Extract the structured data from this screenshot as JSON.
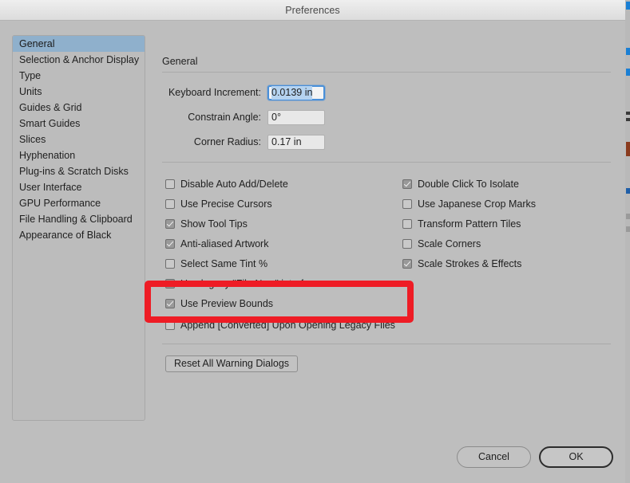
{
  "window": {
    "title": "Preferences"
  },
  "sidebar": {
    "items": [
      {
        "label": "General",
        "selected": true
      },
      {
        "label": "Selection & Anchor Display",
        "selected": false
      },
      {
        "label": "Type",
        "selected": false
      },
      {
        "label": "Units",
        "selected": false
      },
      {
        "label": "Guides & Grid",
        "selected": false
      },
      {
        "label": "Smart Guides",
        "selected": false
      },
      {
        "label": "Slices",
        "selected": false
      },
      {
        "label": "Hyphenation",
        "selected": false
      },
      {
        "label": "Plug-ins & Scratch Disks",
        "selected": false
      },
      {
        "label": "User Interface",
        "selected": false
      },
      {
        "label": "GPU Performance",
        "selected": false
      },
      {
        "label": "File Handling & Clipboard",
        "selected": false
      },
      {
        "label": "Appearance of Black",
        "selected": false
      }
    ]
  },
  "pane": {
    "title": "General",
    "fields": [
      {
        "label": "Keyboard Increment:",
        "value": "0.0139 in",
        "focused": true
      },
      {
        "label": "Constrain Angle:",
        "value": "0°",
        "focused": false
      },
      {
        "label": "Corner Radius:",
        "value": "0.17 in",
        "focused": false
      }
    ],
    "checkboxes_left": [
      {
        "label": "Disable Auto Add/Delete",
        "checked": false
      },
      {
        "label": "Use Precise Cursors",
        "checked": false
      },
      {
        "label": "Show Tool Tips",
        "checked": true
      },
      {
        "label": "Anti-aliased Artwork",
        "checked": true
      },
      {
        "label": "Select Same Tint %",
        "checked": false
      },
      {
        "label": "Use legacy \"File New\" interface",
        "checked": true
      },
      {
        "label": "Use Preview Bounds",
        "checked": true
      }
    ],
    "checkboxes_right": [
      {
        "label": "Double Click To Isolate",
        "checked": true
      },
      {
        "label": "Use Japanese Crop Marks",
        "checked": false
      },
      {
        "label": "Transform Pattern Tiles",
        "checked": false
      },
      {
        "label": "Scale Corners",
        "checked": false
      },
      {
        "label": "Scale Strokes & Effects",
        "checked": true
      }
    ],
    "append_option": {
      "label": "Append [Converted] Upon Opening Legacy Files",
      "checked": false
    },
    "reset_button": "Reset All Warning Dialogs"
  },
  "footer": {
    "cancel_label": "Cancel",
    "ok_label": "OK"
  },
  "colors": {
    "annotation_red": "#ee1c25",
    "selection_blue": "#8fb0cc",
    "focus_blue": "#4a90d9",
    "window_bg": "#bebebe"
  }
}
